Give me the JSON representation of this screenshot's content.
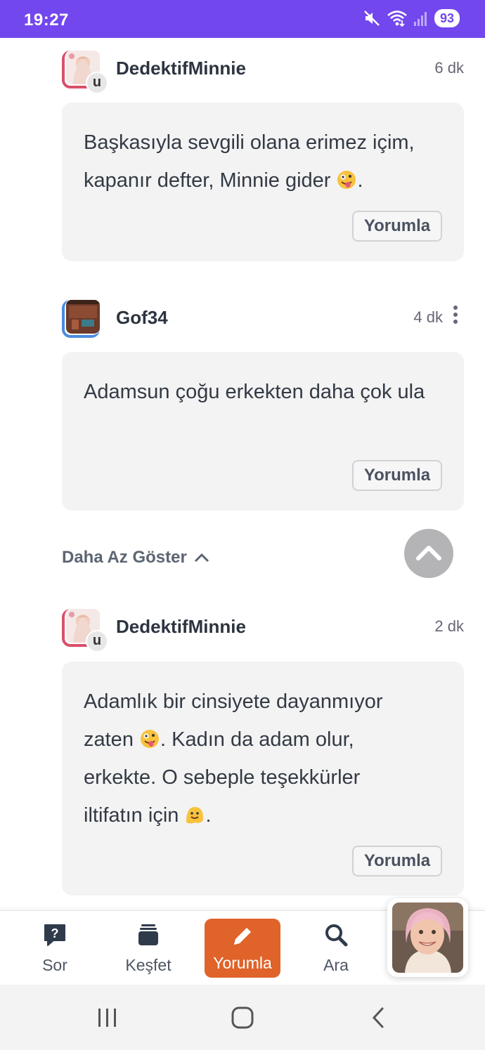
{
  "status_bar": {
    "time": "19:27",
    "battery": "93",
    "icons": [
      "mute-icon",
      "wifi-icon",
      "signal-icon",
      "battery-icon"
    ]
  },
  "comments": [
    {
      "username": "DedektifMinnie",
      "time": "6 dk",
      "badge": "u",
      "text_before_emoji": "Başkasıyla sevgili olana erimez içim, kapanır defter, Minnie gider ",
      "text_after_emoji": ".",
      "emoji": "zany-face-emoji",
      "reply_label": "Yorumla"
    },
    {
      "username": "Gof34",
      "time": "4 dk",
      "text": "Adamsun çoğu erkekten daha çok ula",
      "reply_label": "Yorumla"
    },
    {
      "username": "DedektifMinnie",
      "time": "2 dk",
      "badge": "u",
      "line1": "Adamlık bir cinsiyete dayanmıyor",
      "line2_before": "zaten ",
      "line2_after": ". Kadın da adam olur,",
      "line3": "erkekte. O sebeple teşekkürler",
      "line4_before": "iltifatın için ",
      "line4_after": ".",
      "reply_label": "Yorumla"
    }
  ],
  "show_less_label": "Daha Az Göster",
  "bottom_nav": {
    "items": [
      {
        "label": "Sor",
        "icon": "question-bubble-icon"
      },
      {
        "label": "Keşfet",
        "icon": "stack-icon"
      },
      {
        "label": "Yorumla",
        "icon": "pencil-icon",
        "active": true
      },
      {
        "label": "Ara",
        "icon": "search-icon"
      }
    ]
  },
  "colors": {
    "status_bar": "#7347ee",
    "active_nav": "#e0632a",
    "bubble_bg": "#f3f3f4",
    "avatar_frame_pink": "#d9506a",
    "avatar_frame_blue": "#4a8be0"
  }
}
